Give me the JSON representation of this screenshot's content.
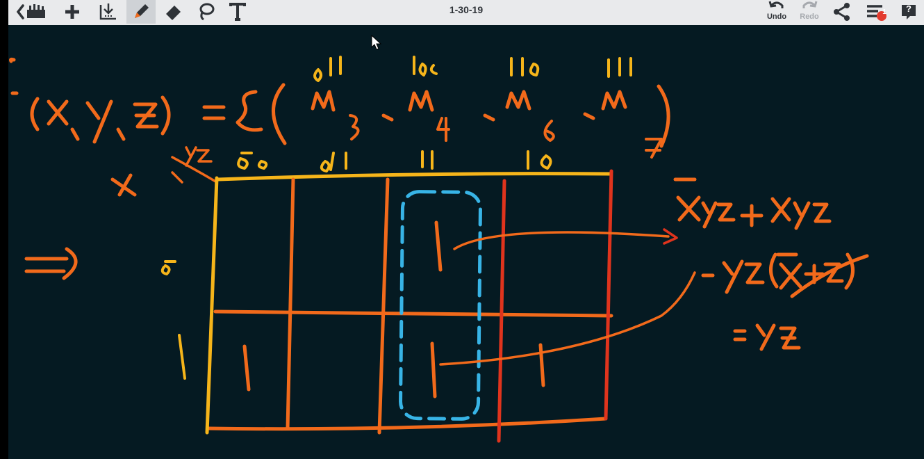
{
  "toolbar": {
    "date": "1-30-19",
    "undo_label": "Undo",
    "redo_label": "Redo",
    "notification_count": "1",
    "help_label": "?"
  },
  "colors": {
    "toolbar_bg": "#e9eaec",
    "board_bg": "#051a22",
    "ink_orange": "#f26a1b",
    "ink_yellow": "#f6b51a",
    "ink_red": "#e0341d",
    "ink_blue": "#38b4e6",
    "badge_red": "#e33b2e"
  },
  "icons": [
    "back-gallery-icon",
    "add-icon",
    "import-icon",
    "pen-icon",
    "eraser-icon",
    "lasso-icon",
    "text-tool-icon",
    "undo-icon",
    "redo-icon",
    "share-icon",
    "menu-icon",
    "help-icon"
  ],
  "board": {
    "handwriting": {
      "function": "(X,y,Z) = Σ(",
      "minterms": [
        {
          "bits": "011",
          "term": "M",
          "index": "3"
        },
        {
          "bits": "100",
          "term": "M",
          "index": "4"
        },
        {
          "bits": "110",
          "term": "M",
          "index": "6"
        },
        {
          "bits": "111",
          "term": "M",
          "index": "7"
        }
      ],
      "kmap_row_var": "x",
      "kmap_col_var": "yz",
      "kmap_cols": [
        "00",
        "01",
        "11",
        "10"
      ],
      "kmap_rows": [
        "0",
        "1"
      ],
      "kmap_cells": [
        [
          "",
          "",
          "1",
          ""
        ],
        [
          "1",
          "",
          "1",
          "1"
        ]
      ],
      "arrow": "⇒",
      "result_line1": "X̄yz + Xyz",
      "result_line2": "= yz(X̄+X)",
      "result_line3": "= yz"
    }
  }
}
